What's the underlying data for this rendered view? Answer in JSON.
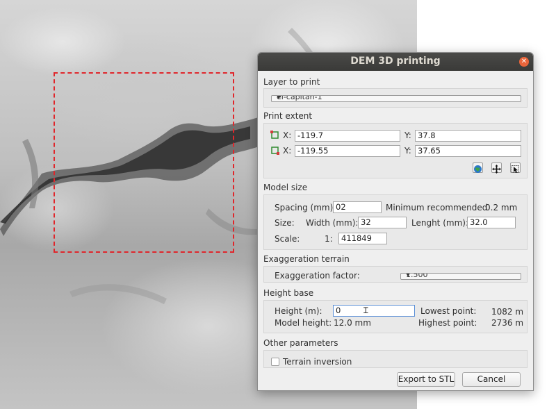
{
  "dialog": {
    "title": "DEM 3D printing",
    "layer_section": "Layer to print",
    "layer_value": "el-capitan-1",
    "extent_section": "Print extent",
    "extent": {
      "x_label": "X:",
      "y_label": "Y:",
      "x1": "-119.7",
      "y1": "37.8",
      "x2": "-119.55",
      "y2": "37.65"
    },
    "model_section": "Model size",
    "spacing_label": "Spacing (mm):",
    "spacing_value": "02",
    "min_rec_label": "Minimum recommended",
    "min_rec_value": "0.2 mm",
    "size_label": "Size:",
    "width_label": "Width (mm):",
    "width_value": "32",
    "length_label": "Lenght (mm):",
    "length_value": "32.0",
    "scale_label": "Scale:",
    "scale_prefix": "1:",
    "scale_value": "411849",
    "exag_section": "Exaggeration terrain",
    "exag_label": "Exaggeration factor:",
    "exag_value": "1.500",
    "height_section": "Height base",
    "height_label": "Height (m):",
    "height_value": "0",
    "lowest_label": "Lowest point:",
    "lowest_value": "1082 m",
    "model_height_label": "Model height:",
    "model_height_value": "12.0 mm",
    "highest_label": "Highest point:",
    "highest_value": "2736 m",
    "other_section": "Other parameters",
    "inversion_label": "Terrain inversion",
    "export_label": "Export to STL",
    "cancel_label": "Cancel"
  },
  "icons": [
    "globe-icon",
    "pan-icon",
    "select-pointer-icon",
    "top-left-corner-icon",
    "bottom-right-corner-icon",
    "close-icon",
    "text-cursor-icon"
  ],
  "colors": {
    "extent_outline": "#e0262b",
    "titlebar": "#3d3d3b",
    "close_button": "#e9653b"
  }
}
